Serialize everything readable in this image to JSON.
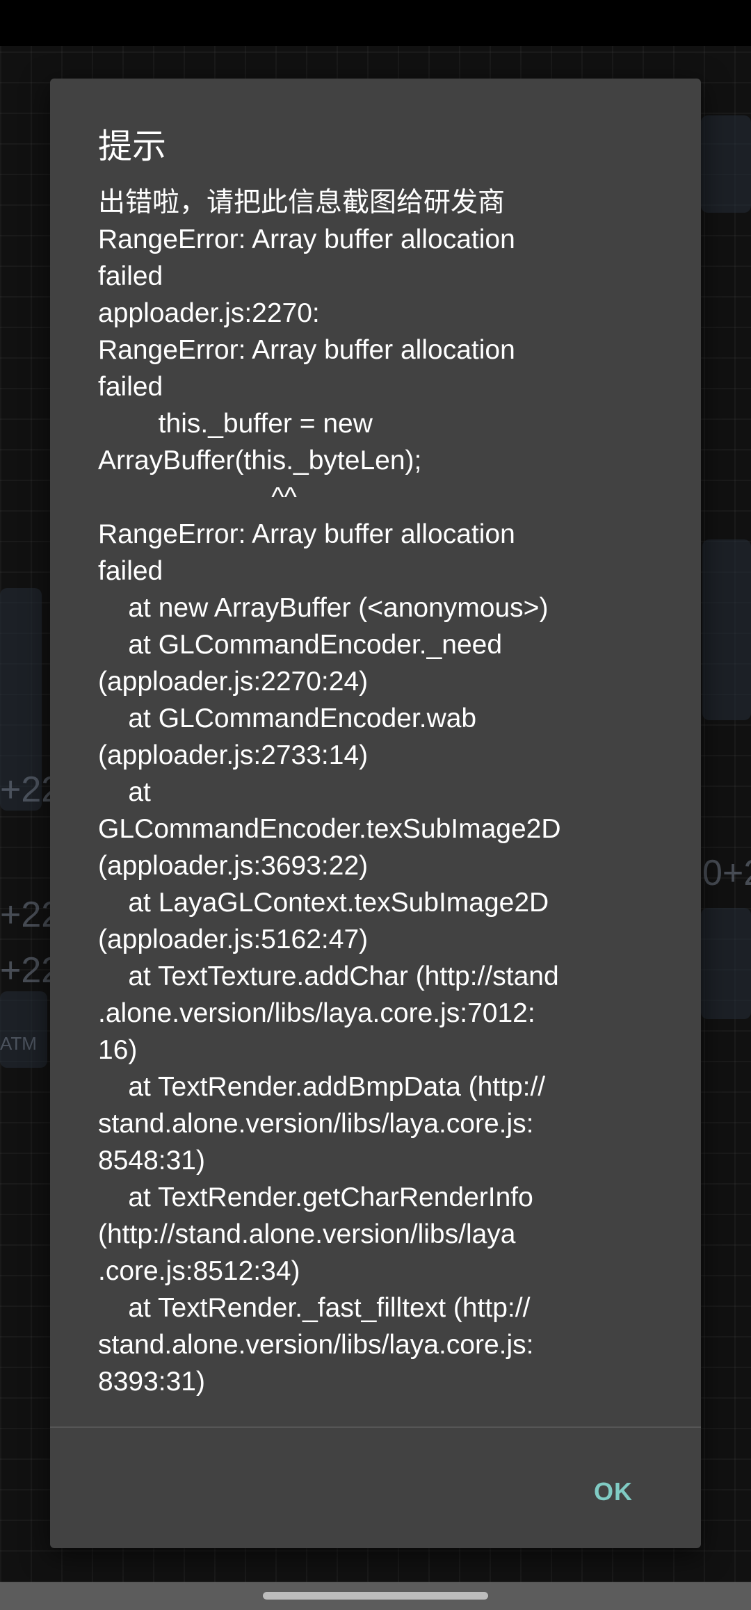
{
  "dialog": {
    "title": "提示",
    "message": "出错啦，请把此信息截图给研发商\nRangeError: Array buffer allocation\nfailed\napploader.js:2270:\nRangeError: Array buffer allocation\nfailed\n        this._buffer = new\nArrayBuffer(this._byteLen);\n                       ^^\nRangeError: Array buffer allocation\nfailed\n    at new ArrayBuffer (<anonymous>)\n    at GLCommandEncoder._need\n(apploader.js:2270:24)\n    at GLCommandEncoder.wab\n(apploader.js:2733:14)\n    at\nGLCommandEncoder.texSubImage2D\n(apploader.js:3693:22)\n    at LayaGLContext.texSubImage2D\n(apploader.js:5162:47)\n    at TextTexture.addChar (http://stand\n.alone.version/libs/laya.core.js:7012:\n16)\n    at TextRender.addBmpData (http://\nstand.alone.version/libs/laya.core.js:\n8548:31)\n    at TextRender.getCharRenderInfo\n(http://stand.alone.version/libs/laya\n.core.js:8512:34)\n    at TextRender._fast_filltext (http://\nstand.alone.version/libs/laya.core.js:\n8393:31)",
    "ok_label": "OK"
  },
  "background": {
    "texts": [
      "+22",
      "+22",
      "+22",
      "0+2",
      "ATM"
    ]
  },
  "colors": {
    "dialog_bg": "#424242",
    "accent": "#80cbc4",
    "text": "#ffffff"
  }
}
